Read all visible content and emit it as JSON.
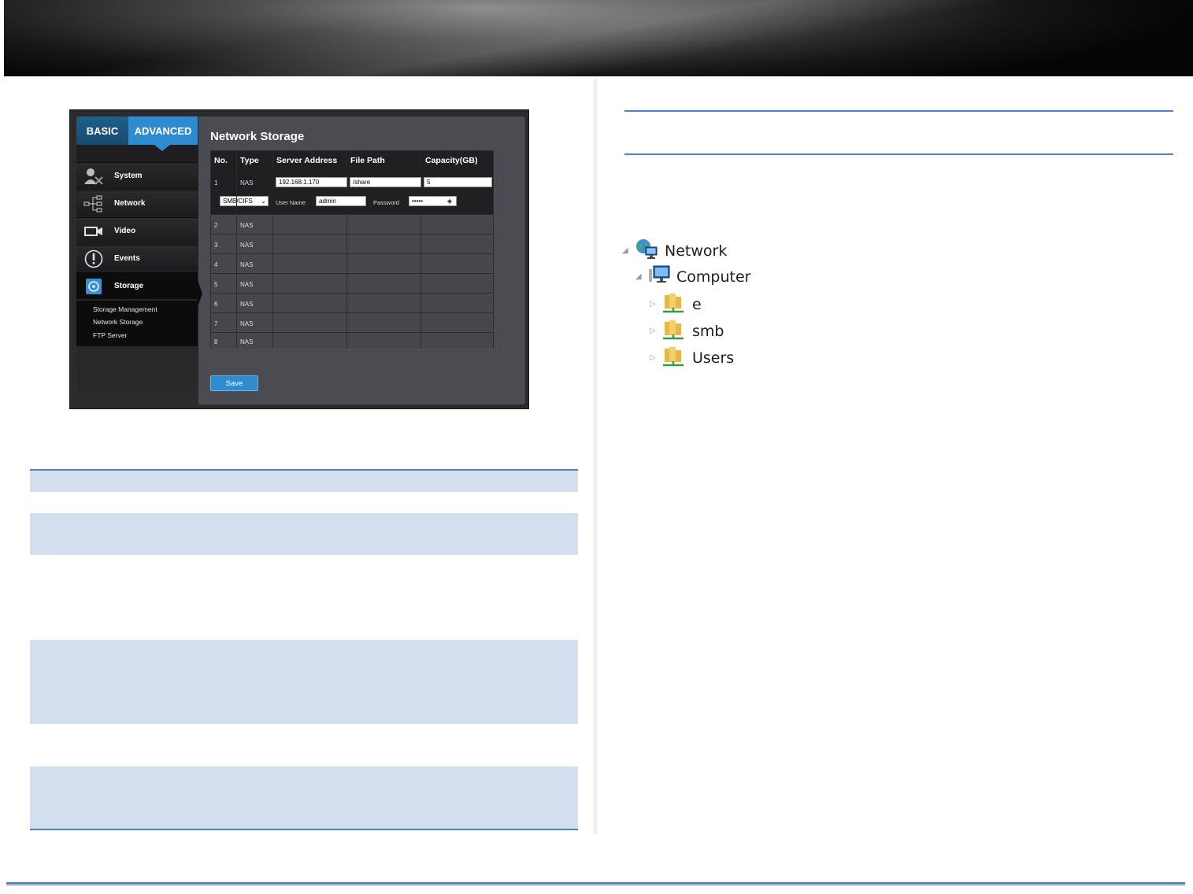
{
  "camera_ui": {
    "tabs": {
      "basic": "BASIC",
      "advanced": "ADVANCED"
    },
    "nav": {
      "system": "System",
      "network": "Network",
      "video": "Video",
      "events": "Events",
      "storage": "Storage"
    },
    "storage_sub": {
      "management": "Storage Management",
      "network_storage": "Network Storage",
      "ftp": "FTP Server"
    },
    "page_title": "Network Storage",
    "table": {
      "headers": [
        "No.",
        "Type",
        "Server Address",
        "File Path",
        "Capacity(GB)"
      ],
      "row1": {
        "no": "1",
        "type": "NAS",
        "server_address": "192.168.1.170",
        "file_path": "/share",
        "capacity": "5",
        "protocol": "SMB/CIFS",
        "user_name_label": "User Name",
        "user_name": "admin",
        "password_label": "Password",
        "password_mask": "•••••"
      },
      "rows": [
        {
          "no": "2",
          "type": "NAS"
        },
        {
          "no": "3",
          "type": "NAS"
        },
        {
          "no": "4",
          "type": "NAS"
        },
        {
          "no": "5",
          "type": "NAS"
        },
        {
          "no": "6",
          "type": "NAS"
        },
        {
          "no": "7",
          "type": "NAS"
        },
        {
          "no": "8",
          "type": "NAS"
        }
      ]
    },
    "save_label": "Save"
  },
  "network_tree": {
    "root": "Network",
    "computer": "Computer",
    "shares": [
      "e",
      "smb",
      "Users"
    ]
  },
  "colors": {
    "accent_blue": "#2f8bd0",
    "doc_rule_blue": "#4f81bd",
    "table_band": "#d3dfee"
  }
}
